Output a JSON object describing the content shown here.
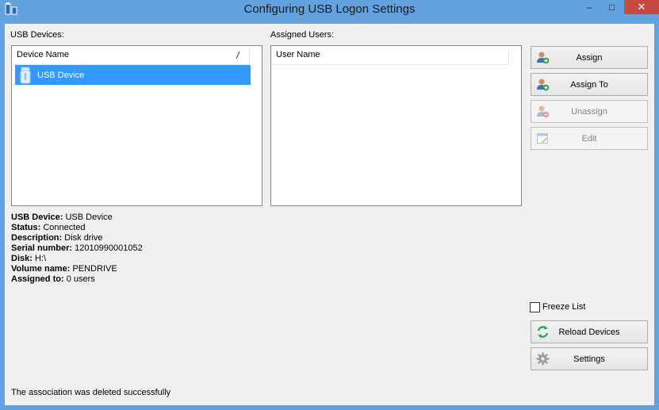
{
  "window": {
    "title": "Configuring USB Logon Settings",
    "controls": {
      "minimize": "–",
      "maximize": "□",
      "close": "✕"
    }
  },
  "usb_devices": {
    "label": "USB Devices:",
    "column_header": "Device Name",
    "items": [
      {
        "name": "USB Device",
        "selected": true,
        "icon": "usb-drive-icon"
      }
    ]
  },
  "assigned_users": {
    "label": "Assigned Users:",
    "column_header": "User Name",
    "items": []
  },
  "buttons": {
    "assign": {
      "label": "Assign",
      "icon": "add-user-icon",
      "enabled": true
    },
    "assign_to": {
      "label": "Assign To",
      "icon": "add-user-icon",
      "enabled": true
    },
    "unassign": {
      "label": "Unassign",
      "icon": "remove-user-icon",
      "enabled": false
    },
    "edit": {
      "label": "Edit",
      "icon": "edit-icon",
      "enabled": false
    },
    "reload": {
      "label": "Reload Devices",
      "icon": "refresh-icon",
      "enabled": true
    },
    "settings": {
      "label": "Settings",
      "icon": "gear-icon",
      "enabled": true
    }
  },
  "details": [
    {
      "key": "USB Device:",
      "value": "USB Device"
    },
    {
      "key": "Status:",
      "value": "Connected"
    },
    {
      "key": "Description:",
      "value": "Disk drive"
    },
    {
      "key": "Serial number:",
      "value": "12010990001052"
    },
    {
      "key": "Disk:",
      "value": "H:\\"
    },
    {
      "key": "Volume name:",
      "value": "PENDRIVE"
    },
    {
      "key": "Assigned to:",
      "value": "0 users"
    }
  ],
  "freeze_list": {
    "label": "Freeze List",
    "checked": false
  },
  "status_message": "The association was deleted successfully",
  "colors": {
    "selection": "#3399ff",
    "titlebar": "#62a3df",
    "close": "#c74a40"
  }
}
